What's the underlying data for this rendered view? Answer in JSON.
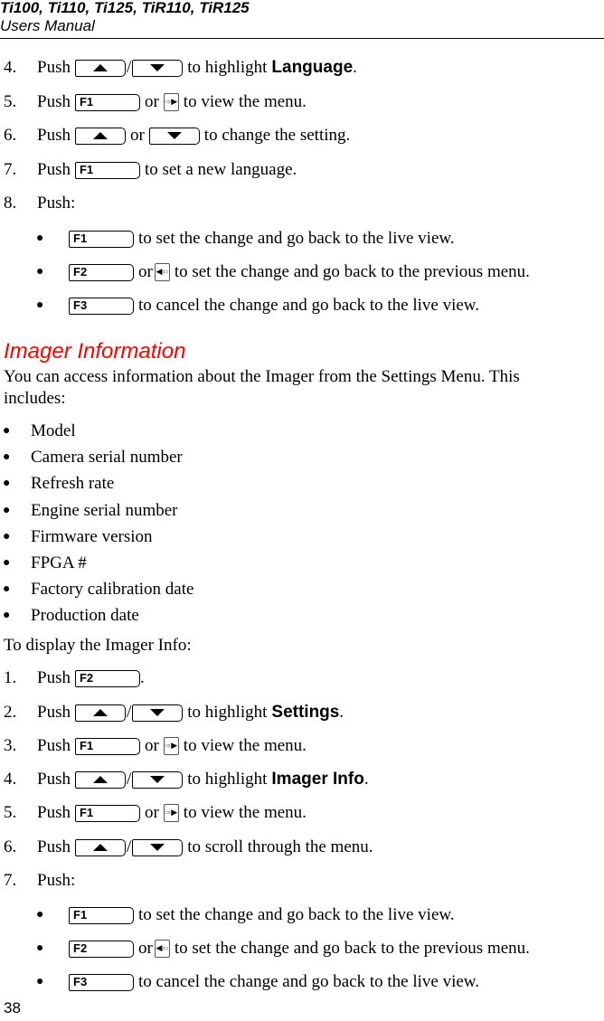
{
  "header": {
    "title": "Ti100, Ti110, Ti125, TiR110, TiR125",
    "subtitle": "Users Manual"
  },
  "keys": {
    "f1": "F1",
    "f2": "F2",
    "f3": "F3",
    "up_icon": "up-arrow-key",
    "down_icon": "down-arrow-key",
    "right_nav_icon": "right-nav-key",
    "left_nav_icon": "left-nav-key"
  },
  "words": {
    "push": "Push",
    "or": "or",
    "slash": "/"
  },
  "steps_top": [
    {
      "num": "4.",
      "suffix": "to highlight",
      "bold": "Language",
      "end": "."
    },
    {
      "num": "5.",
      "suffix": "to view the menu."
    },
    {
      "num": "6.",
      "suffix": "to change the setting."
    },
    {
      "num": "7.",
      "suffix": "to set a new language."
    },
    {
      "num": "8.",
      "text": "Push:"
    }
  ],
  "push_options_top": [
    {
      "key": "F1",
      "text": "to set the change and go back to the live view."
    },
    {
      "key": "F2",
      "text": "to set the change and go back to the previous menu."
    },
    {
      "key": "F3",
      "text": "to cancel the change and go back to the live view."
    }
  ],
  "section": {
    "title": "Imager Information",
    "intro": "You can access information about the Imager from the Settings Menu. This includes:",
    "items": [
      "Model",
      "Camera serial number",
      "Refresh rate",
      "Engine serial number",
      "Firmware version",
      "FPGA #",
      "Factory calibration date",
      "Production date"
    ],
    "display_intro": "To display the Imager Info:"
  },
  "steps_bottom": [
    {
      "num": "1.",
      "end": "."
    },
    {
      "num": "2.",
      "suffix": "to highlight",
      "bold": "Settings",
      "end": "."
    },
    {
      "num": "3.",
      "suffix": "to view the menu."
    },
    {
      "num": "4.",
      "suffix": "to highlight",
      "bold": "Imager Info",
      "end": "."
    },
    {
      "num": "5.",
      "suffix": "to view the menu."
    },
    {
      "num": "6.",
      "suffix": "to scroll through the menu."
    },
    {
      "num": "7.",
      "text": "Push:"
    }
  ],
  "push_options_bottom": [
    {
      "key": "F1",
      "text": "to set the change and go back to the live view."
    },
    {
      "key": "F2",
      "text": "to set the change and go back to the previous menu."
    },
    {
      "key": "F3",
      "text": "to cancel the change and go back to the live view."
    }
  ],
  "page_number": "38"
}
